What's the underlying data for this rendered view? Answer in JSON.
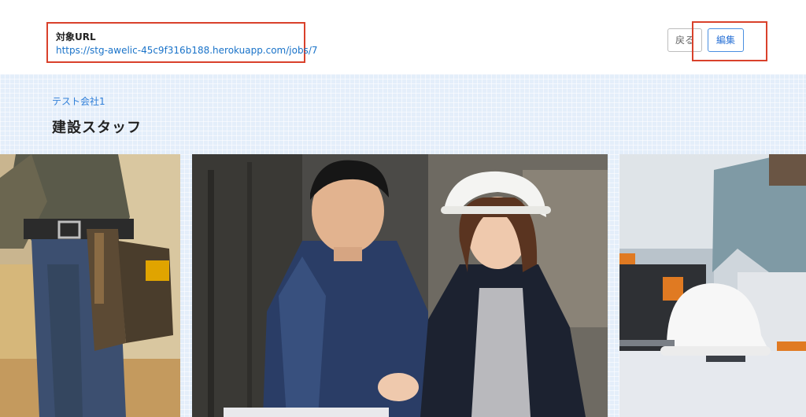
{
  "header": {
    "target_url_label": "対象URL",
    "target_url": "https://stg-awelic-45c9f316b188.herokuapp.com/jobs/7",
    "back_label": "戻る",
    "edit_label": "編集"
  },
  "job": {
    "company": "テスト会社1",
    "title": "建設スタッフ"
  },
  "colors": {
    "accent": "#2f7fd8",
    "highlight_box": "#d9412b",
    "band_background": "#e4eefa"
  },
  "gallery": {
    "photos": [
      {
        "name": "worker-tool-belt-photo"
      },
      {
        "name": "workers-reviewing-laptop-photo"
      },
      {
        "name": "hardhat-on-desk-photo"
      }
    ]
  }
}
